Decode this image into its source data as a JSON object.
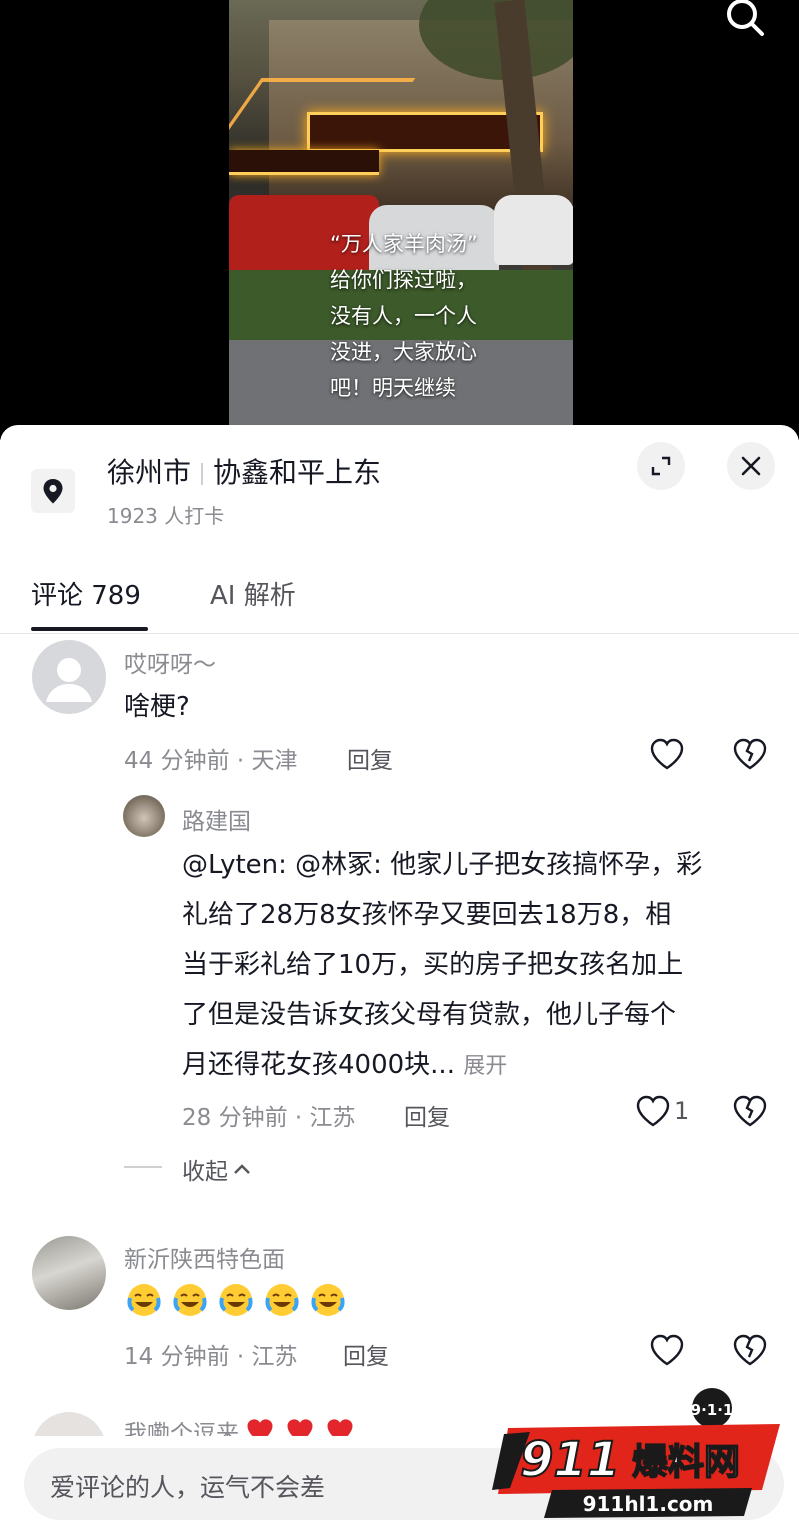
{
  "video": {
    "caption": "“万人家羊肉汤”\n给你们探过啦，\n没有人，一个人\n没进，大家放心\n吧！明天继续"
  },
  "location": {
    "city": "徐州市",
    "place": "协鑫和平上东",
    "checkins": "1923 人打卡"
  },
  "tabs": [
    {
      "label": "评论 789",
      "active": true
    },
    {
      "label": "AI 解析",
      "active": false
    }
  ],
  "comments": [
    {
      "user": "哎呀呀～",
      "text": "啥梗?",
      "meta": "44 分钟前 · 天津",
      "reply_label": "回复",
      "likes": ""
    },
    {
      "user": "路建国",
      "text_lines": [
        "@Lyten: @林冢: 他家儿子把女孩搞怀孕，彩",
        "礼给了28万8女孩怀孕又要回去18万8，相",
        "当于彩礼给了10万，买的房子把女孩名加上",
        "了但是没告诉女孩父母有贷款，他儿子每个",
        "月还得花女孩4000块..."
      ],
      "expand_label": "展开",
      "meta": "28 分钟前 · 江苏",
      "reply_label": "回复",
      "likes": "1"
    },
    {
      "user": "新沂陕西特色面",
      "emoji": [
        "crying-laughing-emoji",
        "crying-laughing-emoji",
        "crying-laughing-emoji",
        "crying-laughing-emoji",
        "crying-laughing-emoji"
      ],
      "meta": "14 分钟前 · 江苏",
      "reply_label": "回复",
      "likes": ""
    },
    {
      "user": "我嘞个逗来",
      "emoji": [
        "red-heart-emoji",
        "red-heart-emoji",
        "red-heart-emoji"
      ]
    }
  ],
  "collapse_label": "收起",
  "input": {
    "placeholder": "爱评论的人，运气不会差"
  },
  "watermark": {
    "badge": "9·1·1",
    "brand_num": "911",
    "brand_text": "爆料网",
    "url": "911hl1.com"
  },
  "colors": {
    "text_primary": "#161823",
    "text_secondary": "#8a8b91",
    "watermark_red": "#e1251b"
  }
}
